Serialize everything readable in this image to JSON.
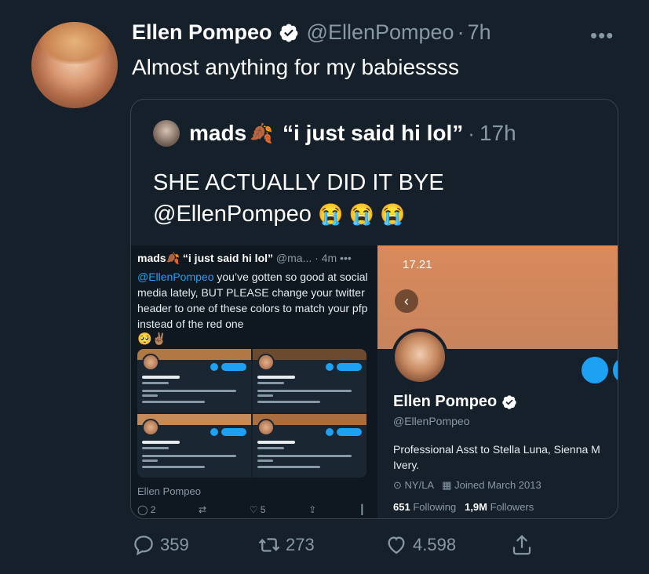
{
  "tweet": {
    "name": "Ellen Pompeo",
    "handle": "@EllenPompeo",
    "dot": "·",
    "time": "7h",
    "text": "Almost anything for my babiessss",
    "more": "•••"
  },
  "quote": {
    "name": "mads",
    "leaf": "🍂",
    "display": "“i just said hi lol”",
    "dot": "·",
    "time": "17h",
    "text_line1": "SHE ACTUALLY DID IT BYE",
    "text_line2": "@EllenPompeo",
    "emojis": "😭 😭 😭"
  },
  "left_screenshot": {
    "name": "mads🍂 “i just said hi lol”",
    "handle": "@ma...",
    "time": "· 4m",
    "more": "•••",
    "mention": "@EllenPompeo",
    "text": " you’ve gotten so good at social media lately, BUT PLEASE change your twitter header to one of these colors to match your pfp instead of the red one",
    "emoji": "🥺✌🏽",
    "footer_label": "Ellen Pompeo",
    "reply_count": "2",
    "like_count": "5"
  },
  "right_screenshot": {
    "status_time": "17.21",
    "back": "‹",
    "name": "Ellen Pompeo",
    "handle": "@EllenPompeo",
    "bio_line1": "Professional Asst to Stella Luna, Sienna M",
    "bio_line2": "Ivery.",
    "location": "NY/LA",
    "joined": "Joined March 2013",
    "following_count": "651",
    "following_label": "Following",
    "followers_count": "1,9M",
    "followers_label": "Followers"
  },
  "actions": {
    "replies": "359",
    "retweets": "273",
    "likes": "4.598"
  },
  "colors": {
    "background": "#15202b",
    "accent": "#1da1f2",
    "secondary_text": "#8899a6"
  }
}
